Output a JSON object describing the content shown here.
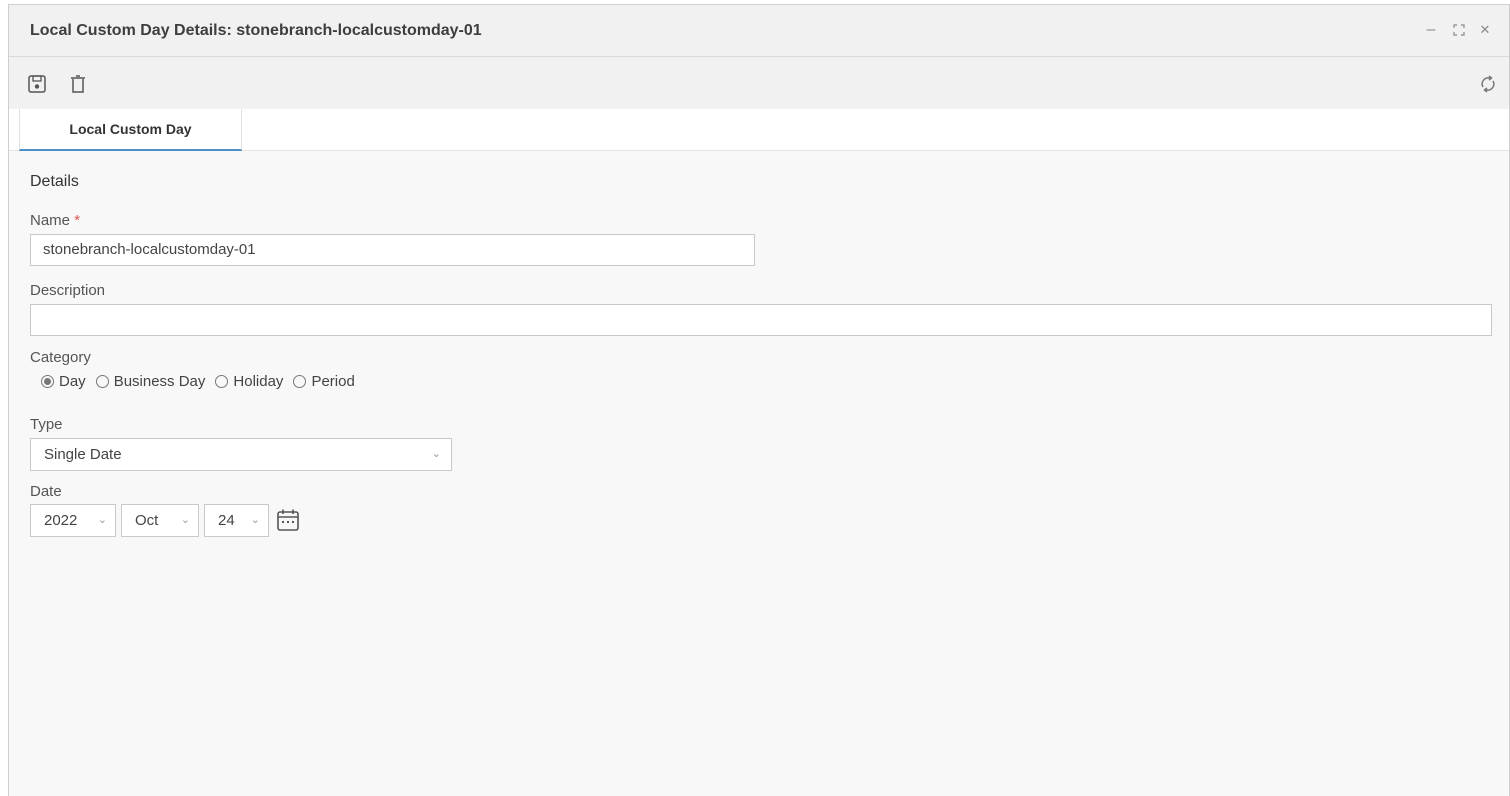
{
  "window": {
    "title": "Local Custom Day Details: stonebranch-localcustomday-01",
    "controls": {
      "minimize": "–",
      "maximize": "⛶",
      "close": "✕"
    }
  },
  "toolbar": {
    "icons": [
      "save-icon",
      "delete-icon",
      "refresh-icon"
    ]
  },
  "tabs": [
    {
      "label": "Local Custom Day",
      "active": true
    }
  ],
  "details": {
    "section_title": "Details",
    "name": {
      "label": "Name",
      "required_mark": "*",
      "value": "stonebranch-localcustomday-01"
    },
    "description": {
      "label": "Description",
      "value": ""
    },
    "category": {
      "label": "Category",
      "options": [
        "Day",
        "Business Day",
        "Holiday",
        "Period"
      ],
      "selected": "Day"
    },
    "type": {
      "label": "Type",
      "value": "Single Date"
    },
    "date": {
      "label": "Date",
      "year": "2022",
      "month": "Oct",
      "day": "24"
    }
  }
}
